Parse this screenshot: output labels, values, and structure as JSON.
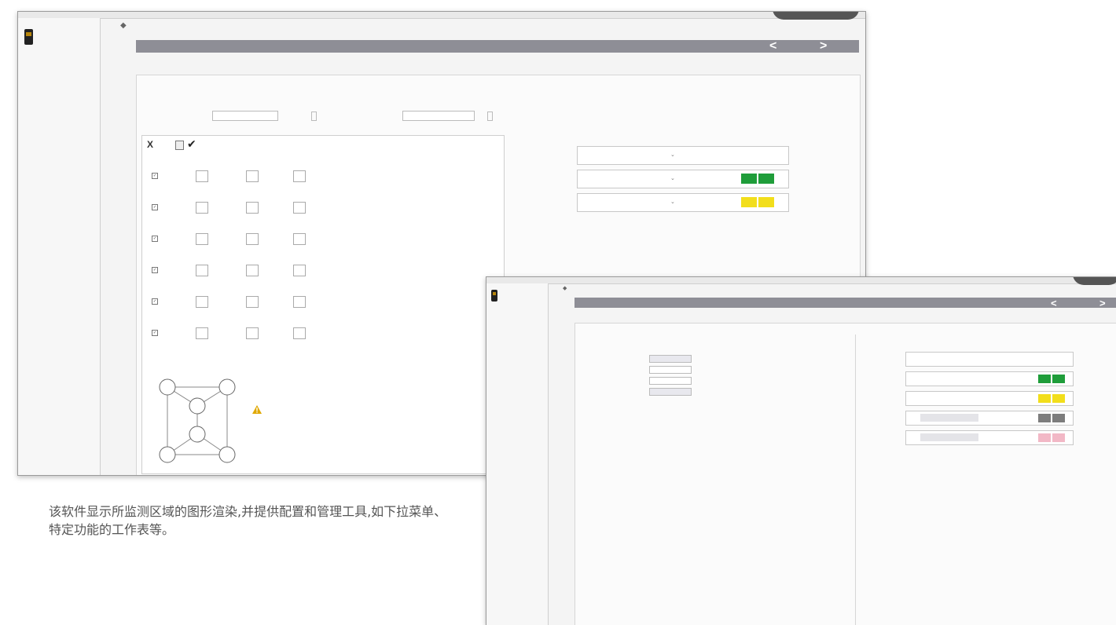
{
  "colors": {
    "navbar": "#8e8e96",
    "green": "#1f9d3a",
    "yellow": "#f2de1b",
    "gray": "#7d7d7d",
    "pink": "#f2b8c6",
    "warning": "#e0a800"
  },
  "zone_config_screen": {
    "sidebar": {
      "device_label": "",
      "line2": "",
      "line3": ""
    },
    "nav": {
      "tabs": [
        "",
        "",
        ""
      ],
      "prev": "<",
      "next": ">"
    },
    "panel_title": "",
    "zone_sets": {
      "section_label": "",
      "zoneset_no_label": "",
      "zoneset_no_value": "",
      "input_delay_label": "",
      "input_delay_value": ""
    },
    "toolbar": {
      "delete_icon": "X",
      "label": "",
      "save_icon": "save-icon",
      "apply_icon": "✔"
    },
    "columns": [
      "",
      "",
      ""
    ],
    "rows": [
      {
        "name": "",
        "checked": true,
        "values": [
          "",
          "",
          ""
        ]
      },
      {
        "name": "",
        "checked": true,
        "values": [
          "",
          "",
          ""
        ]
      },
      {
        "name": "",
        "checked": true,
        "values": [
          "",
          "",
          ""
        ]
      },
      {
        "name": "",
        "checked": true,
        "values": [
          "",
          "",
          ""
        ]
      },
      {
        "name": "",
        "checked": true,
        "values": [
          "",
          "",
          ""
        ]
      },
      {
        "name": "",
        "checked": true,
        "values": [
          "",
          "",
          ""
        ]
      }
    ],
    "input_signals": {
      "label": "",
      "rows": [
        {
          "pin": "",
          "func": "",
          "color_name": "",
          "swatch": "none"
        },
        {
          "pin": "",
          "func": "",
          "color_name": "",
          "swatch": "green"
        },
        {
          "pin": "",
          "func": "",
          "color_name": "",
          "swatch": "yellow"
        }
      ]
    },
    "graph": {
      "title": "",
      "nodes": [
        "",
        "",
        "",
        "",
        "",
        ""
      ],
      "warning_text": ""
    }
  },
  "output_config_screen": {
    "sidebar": {
      "device_label": "",
      "line2": "",
      "line3": ""
    },
    "nav": {
      "tabs": [
        "",
        "",
        ""
      ],
      "prev": "<",
      "next": ">"
    },
    "panel_title": "",
    "output_function": {
      "label": "",
      "fields": [
        {
          "label": "",
          "value": ""
        },
        {
          "label": "",
          "value": ""
        },
        {
          "label": "",
          "value": ""
        },
        {
          "label": "",
          "value": ""
        }
      ]
    },
    "output_signals": {
      "label": "",
      "rows": [
        {
          "pin": "",
          "func": "",
          "color_name": "",
          "swatch": "none"
        },
        {
          "pin": "",
          "func": "",
          "color_name": "",
          "swatch": "green"
        },
        {
          "pin": "",
          "func": "",
          "color_name": "",
          "swatch": "yellow"
        },
        {
          "pin": "",
          "func": "",
          "color_name": "",
          "swatch": "gray"
        },
        {
          "pin": "",
          "func": "",
          "color_name": "",
          "swatch": "pink"
        }
      ]
    }
  },
  "caption": "该软件显示所监测区域的图形渲染,并提供配置和管理工具,如下拉菜单、特定功能的工作表等。"
}
